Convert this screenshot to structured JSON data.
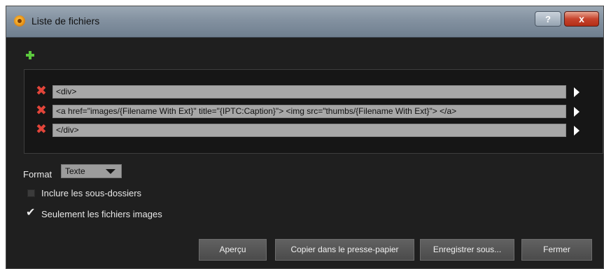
{
  "window": {
    "title": "Liste de fichiers",
    "help_label": "?",
    "close_label": "x"
  },
  "rows": [
    {
      "value": "<div>"
    },
    {
      "value": "<a href=\"images/{Filename With Ext}\" title=\"{IPTC:Caption}\"> <img src=\"thumbs/{Filename With Ext}\"> </a>"
    },
    {
      "value": "</div>"
    }
  ],
  "format": {
    "label": "Format",
    "selected": "Texte"
  },
  "options": {
    "include_subfolders": {
      "label": "Inclure les sous-dossiers",
      "checked": false
    },
    "images_only": {
      "label": "Seulement les fichiers images",
      "checked": true
    }
  },
  "buttons": {
    "preview": "Aperçu",
    "copy": "Copier dans le presse-papier",
    "save": "Enregistrer sous...",
    "close": "Fermer"
  },
  "colors": {
    "background": "#1f1f1f",
    "field": "#a7a7a7",
    "delete": "#e2453a",
    "add": "#5cc93e"
  }
}
